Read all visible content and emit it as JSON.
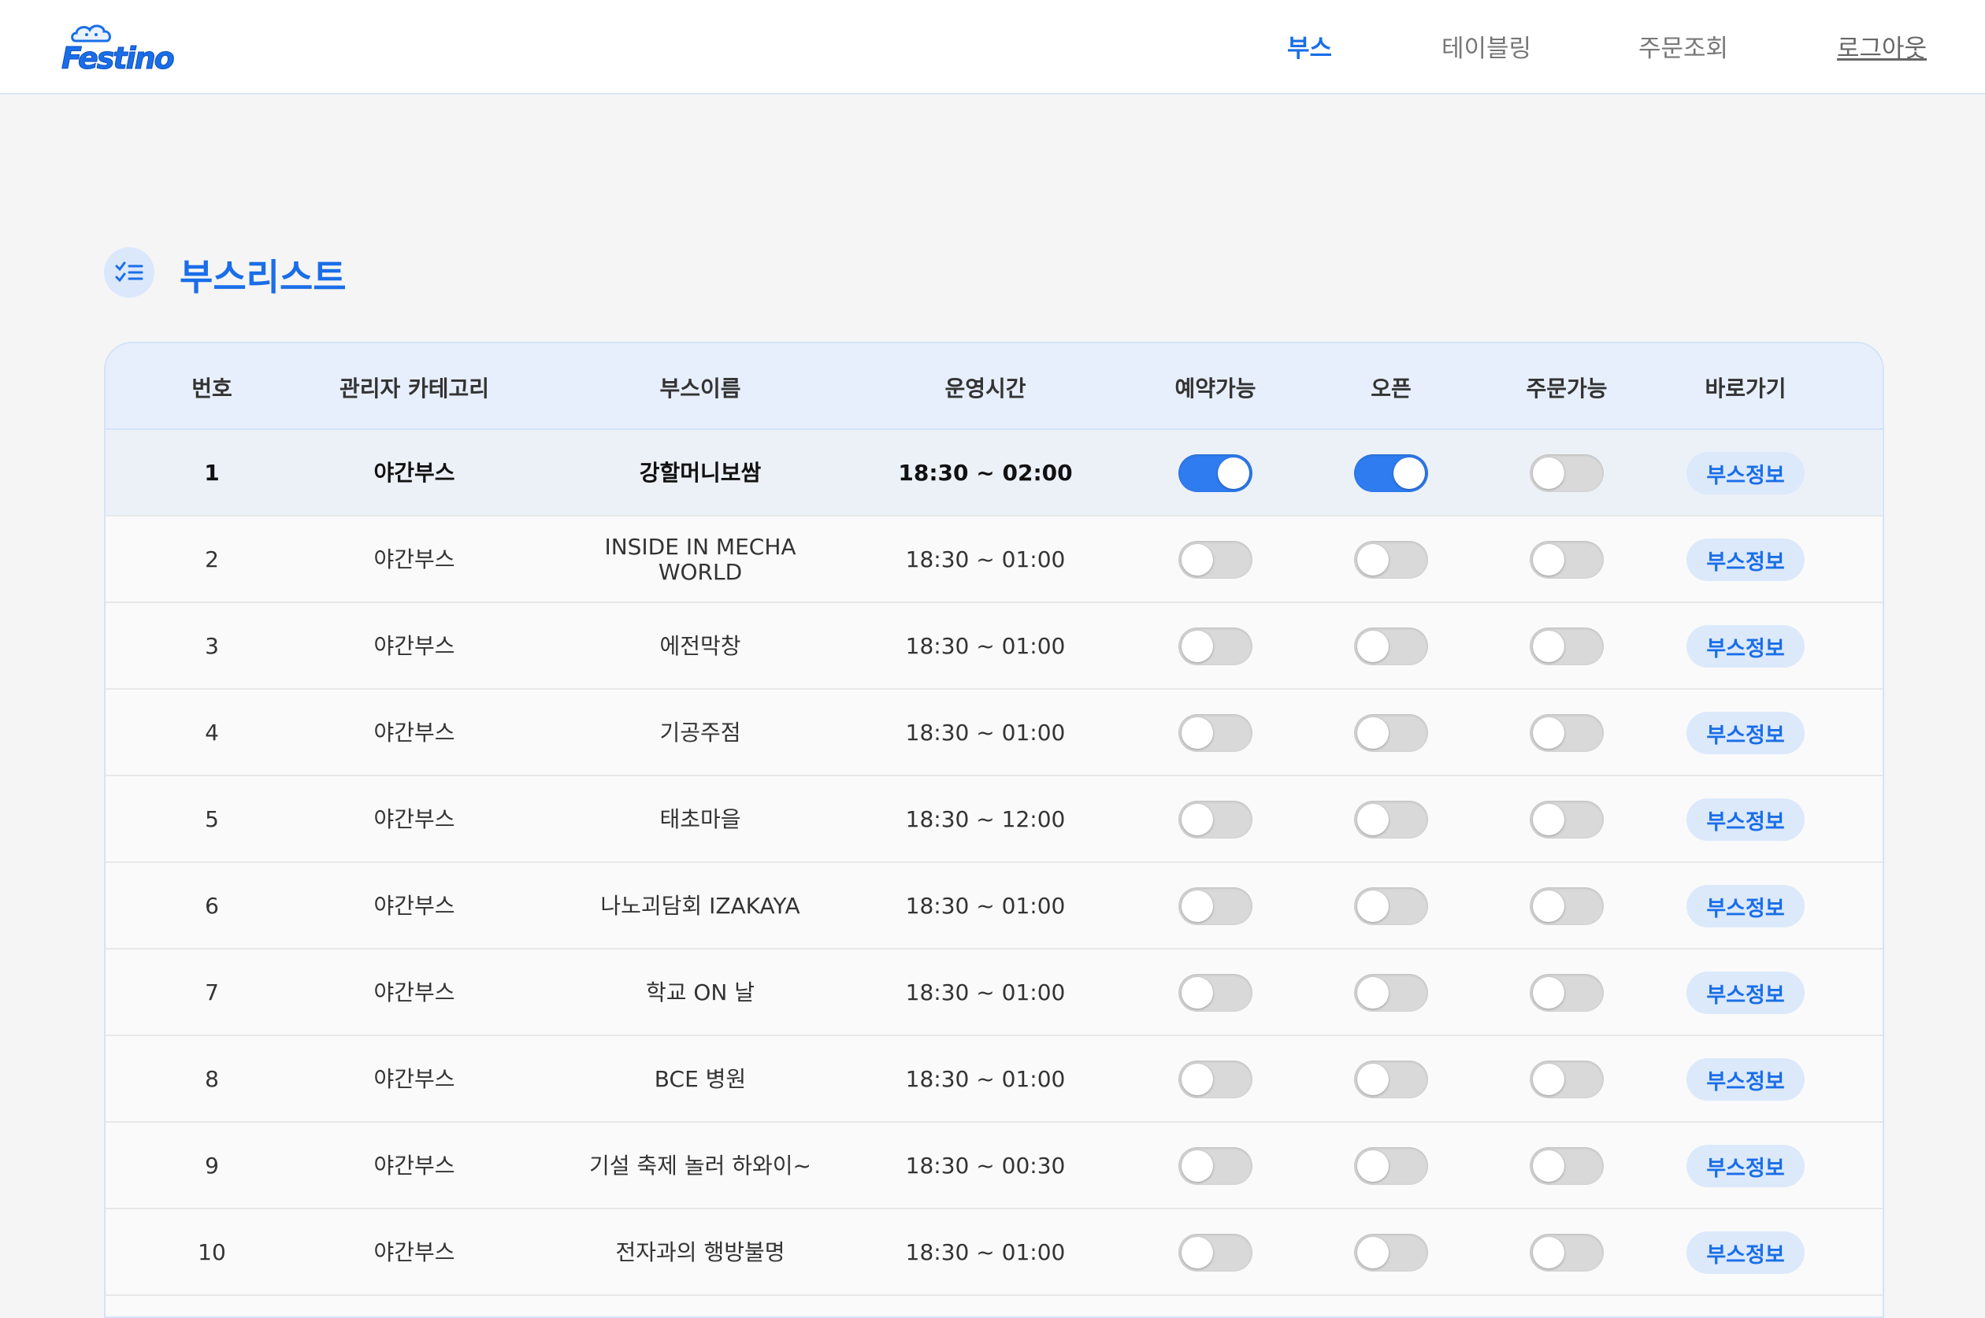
{
  "brand": {
    "logo_text": "Festino"
  },
  "nav": {
    "items": [
      {
        "label": "부스",
        "active": true
      },
      {
        "label": "테이블링",
        "active": false
      },
      {
        "label": "주문조회",
        "active": false
      },
      {
        "label": "로그아웃",
        "active": false
      }
    ]
  },
  "page": {
    "title": "부스리스트"
  },
  "table": {
    "headers": [
      "번호",
      "관리자 카테고리",
      "부스이름",
      "운영시간",
      "예약가능",
      "오픈",
      "주문가능",
      "바로가기"
    ],
    "action_label": "부스정보",
    "rows": [
      {
        "no": "1",
        "category": "야간부스",
        "name": "강할머니보쌈",
        "hours": "18:30 ~ 02:00",
        "reserve": true,
        "open": true,
        "order": false,
        "selected": true
      },
      {
        "no": "2",
        "category": "야간부스",
        "name": "INSIDE IN MECHA WORLD",
        "hours": "18:30 ~ 01:00",
        "reserve": false,
        "open": false,
        "order": false
      },
      {
        "no": "3",
        "category": "야간부스",
        "name": "에전막창",
        "hours": "18:30 ~ 01:00",
        "reserve": false,
        "open": false,
        "order": false
      },
      {
        "no": "4",
        "category": "야간부스",
        "name": "기공주점",
        "hours": "18:30 ~ 01:00",
        "reserve": false,
        "open": false,
        "order": false
      },
      {
        "no": "5",
        "category": "야간부스",
        "name": "태초마을",
        "hours": "18:30 ~ 12:00",
        "reserve": false,
        "open": false,
        "order": false
      },
      {
        "no": "6",
        "category": "야간부스",
        "name": "나노괴담회 IZAKAYA",
        "hours": "18:30 ~ 01:00",
        "reserve": false,
        "open": false,
        "order": false
      },
      {
        "no": "7",
        "category": "야간부스",
        "name": "학교 ON 날",
        "hours": "18:30 ~ 01:00",
        "reserve": false,
        "open": false,
        "order": false
      },
      {
        "no": "8",
        "category": "야간부스",
        "name": "BCE 병원",
        "hours": "18:30 ~ 01:00",
        "reserve": false,
        "open": false,
        "order": false
      },
      {
        "no": "9",
        "category": "야간부스",
        "name": "기설 축제 놀러 하와이~",
        "hours": "18:30 ~ 00:30",
        "reserve": false,
        "open": false,
        "order": false
      },
      {
        "no": "10",
        "category": "야간부스",
        "name": "전자과의 행방불명",
        "hours": "18:30 ~ 01:00",
        "reserve": false,
        "open": false,
        "order": false
      }
    ]
  },
  "colors": {
    "accent": "#1a6ee8",
    "toggle_on": "#2f7cf0",
    "toggle_off": "#d9d9d9",
    "header_bg": "#e6effb"
  }
}
